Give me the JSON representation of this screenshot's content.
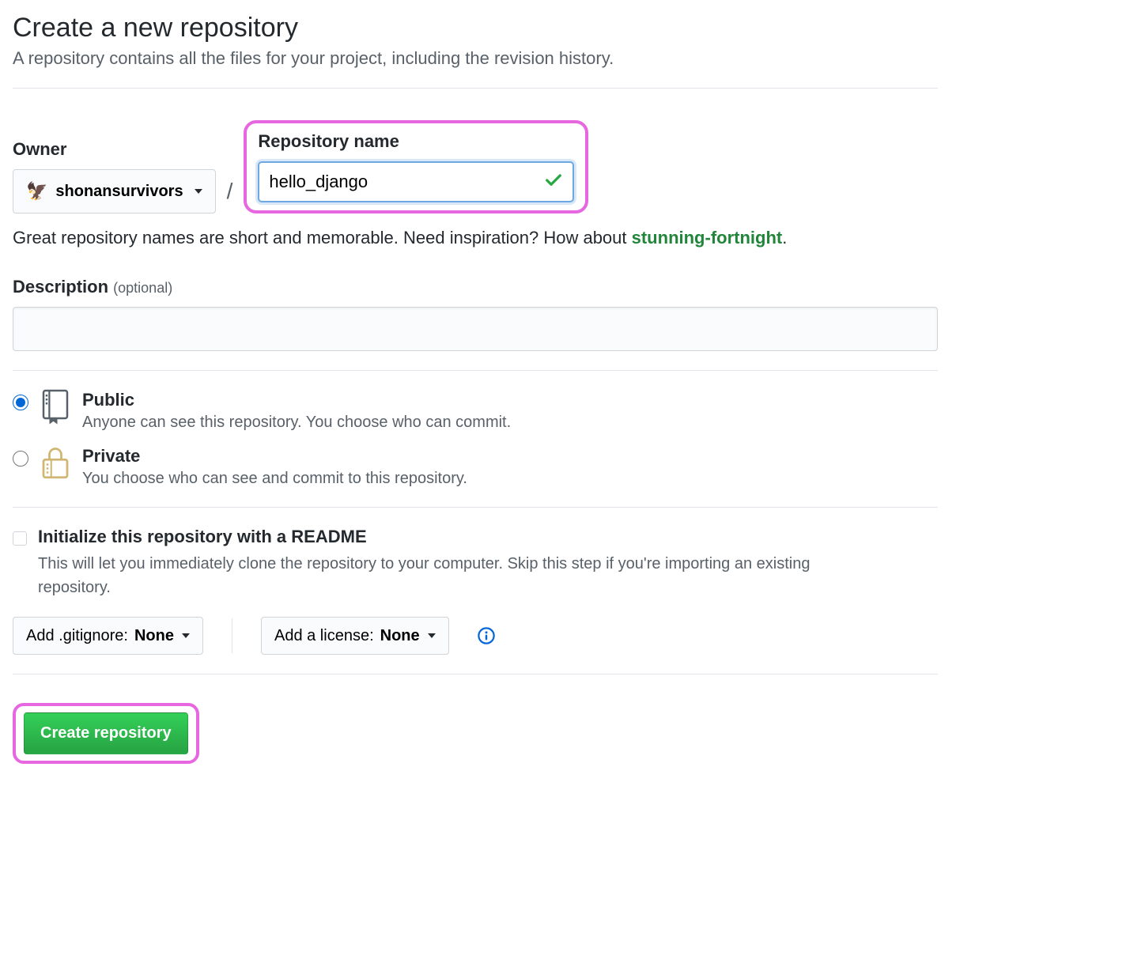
{
  "header": {
    "title": "Create a new repository",
    "subtitle": "A repository contains all the files for your project, including the revision history."
  },
  "owner": {
    "label": "Owner",
    "username": "shonansurvivors",
    "avatar_emoji": "🦅"
  },
  "repo": {
    "label": "Repository name",
    "value": "hello_django"
  },
  "hint": {
    "prefix": "Great repository names are short and memorable. Need inspiration? How about ",
    "suggestion": "stunning-fortnight",
    "suffix": "."
  },
  "description": {
    "label": "Description",
    "optional": "(optional)",
    "value": ""
  },
  "visibility": {
    "public": {
      "title": "Public",
      "desc": "Anyone can see this repository. You choose who can commit.",
      "checked": true
    },
    "private": {
      "title": "Private",
      "desc": "You choose who can see and commit to this repository.",
      "checked": false
    }
  },
  "readme": {
    "title": "Initialize this repository with a README",
    "desc": "This will let you immediately clone the repository to your computer. Skip this step if you're importing an existing repository.",
    "checked": false
  },
  "gitignore": {
    "prefix": "Add .gitignore: ",
    "value": "None"
  },
  "license": {
    "prefix": "Add a license: ",
    "value": "None"
  },
  "create_button": "Create repository"
}
